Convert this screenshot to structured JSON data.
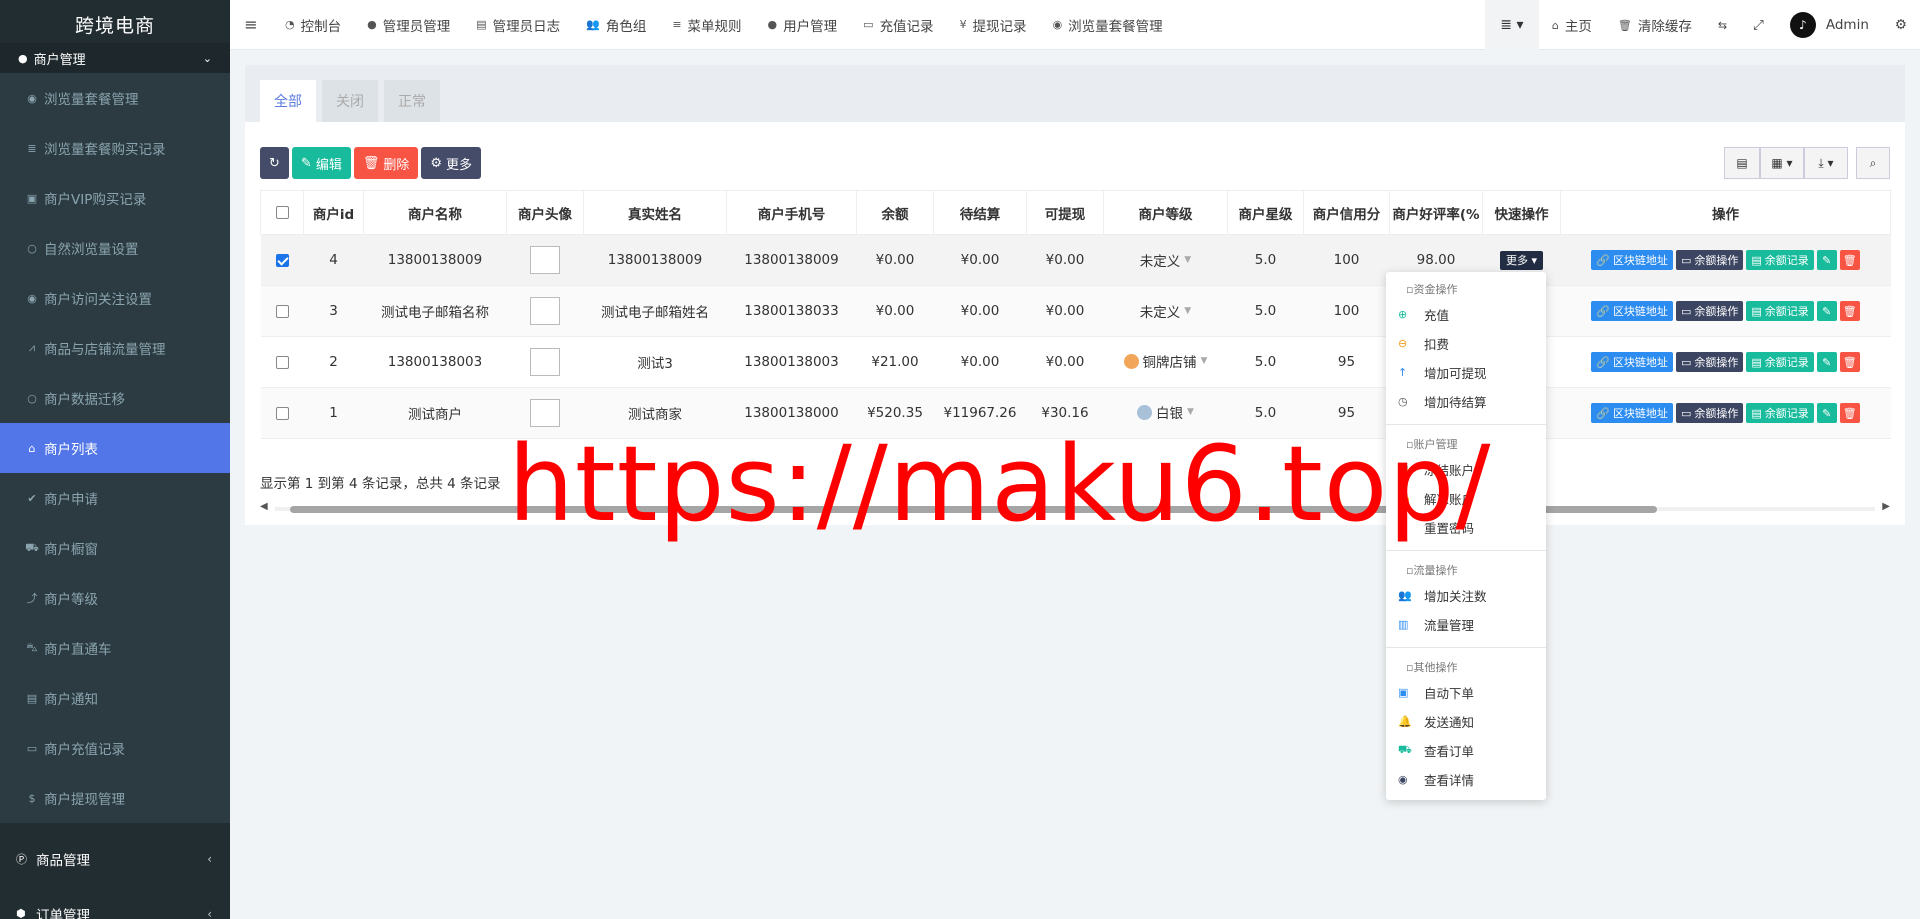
{
  "app": {
    "title": "跨境电商"
  },
  "sidebar": {
    "group_open": "商户管理",
    "items": [
      {
        "icon": "eye-icon",
        "glyph": "◉",
        "label": "浏览量套餐管理"
      },
      {
        "icon": "list-icon",
        "glyph": "≣",
        "label": "浏览量套餐购买记录"
      },
      {
        "icon": "shopping-bag-icon",
        "glyph": "▣",
        "label": "商户VIP购买记录"
      },
      {
        "icon": "circle-icon",
        "glyph": "○",
        "label": "自然浏览量设置"
      },
      {
        "icon": "eye-icon",
        "glyph": "◉",
        "label": "商户访问关注设置"
      },
      {
        "icon": "line-chart-icon",
        "glyph": "⩘",
        "label": "商品与店铺流量管理"
      },
      {
        "icon": "circle-icon",
        "glyph": "○",
        "label": "商户数据迁移"
      },
      {
        "icon": "home-icon",
        "glyph": "⌂",
        "label": "商户列表"
      },
      {
        "icon": "check-circle-icon",
        "glyph": "✔",
        "label": "商户申请"
      },
      {
        "icon": "cart-icon",
        "glyph": "⛟",
        "label": "商户橱窗"
      },
      {
        "icon": "level-up-icon",
        "glyph": "⤴",
        "label": "商户等级"
      },
      {
        "icon": "car-icon",
        "glyph": "⛍",
        "label": "商户直通车"
      },
      {
        "icon": "newspaper-icon",
        "glyph": "▤",
        "label": "商户通知"
      },
      {
        "icon": "money-icon",
        "glyph": "▭",
        "label": "商户充值记录"
      },
      {
        "icon": "dollar-icon",
        "glyph": "$",
        "label": "商户提现管理"
      }
    ],
    "bottom": [
      {
        "icon": "product-hunt-icon",
        "glyph": "Ⓟ",
        "label": "商品管理"
      },
      {
        "icon": "cube-icon",
        "glyph": "⬢",
        "label": "订单管理"
      }
    ]
  },
  "topbar": {
    "items": [
      {
        "icon": "dashboard-icon",
        "glyph": "◔",
        "label": "控制台"
      },
      {
        "icon": "user-icon",
        "glyph": "●",
        "label": "管理员管理"
      },
      {
        "icon": "list-alt-icon",
        "glyph": "▤",
        "label": "管理员日志"
      },
      {
        "icon": "users-icon",
        "glyph": "👥",
        "label": "角色组"
      },
      {
        "icon": "bars-icon",
        "glyph": "≡",
        "label": "菜单规则"
      },
      {
        "icon": "user-icon",
        "glyph": "●",
        "label": "用户管理"
      },
      {
        "icon": "money-icon",
        "glyph": "▭",
        "label": "充值记录"
      },
      {
        "icon": "yen-icon",
        "glyph": "¥",
        "label": "提现记录"
      },
      {
        "icon": "eye-icon",
        "glyph": "◉",
        "label": "浏览量套餐管理"
      }
    ],
    "home": "主页",
    "clear_cache": "清除缓存",
    "user": "Admin"
  },
  "tabs": [
    "全部",
    "关闭",
    "正常"
  ],
  "toolbar": {
    "edit": "编辑",
    "delete": "删除",
    "more": "更多"
  },
  "table": {
    "headers": [
      "商户id",
      "商户名称",
      "商户头像",
      "真实姓名",
      "商户手机号",
      "余额",
      "待结算",
      "可提现",
      "商户等级",
      "商户星级",
      "商户信用分",
      "商户好评率(%",
      "快速操作",
      "操作"
    ],
    "rows": [
      {
        "id": "4",
        "name": "13800138009",
        "real": "13800138009",
        "phone": "13800138009",
        "balance": "¥0.00",
        "pending": "¥0.00",
        "withdraw": "¥0.00",
        "level": "未定义",
        "star": "5.0",
        "credit": "100",
        "rate": "98.00",
        "checked": true
      },
      {
        "id": "3",
        "name": "测试电子邮箱名称",
        "real": "测试电子邮箱姓名",
        "phone": "13800138033",
        "balance": "¥0.00",
        "pending": "¥0.00",
        "withdraw": "¥0.00",
        "level": "未定义",
        "star": "5.0",
        "credit": "100",
        "rate": "",
        "checked": false
      },
      {
        "id": "2",
        "name": "13800138003",
        "real": "测试3",
        "phone": "13800138003",
        "balance": "¥21.00",
        "pending": "¥0.00",
        "withdraw": "¥0.00",
        "level": "铜牌店铺",
        "star": "5.0",
        "credit": "95",
        "rate": "",
        "checked": false
      },
      {
        "id": "1",
        "name": "测试商户",
        "real": "测试商家",
        "phone": "13800138000",
        "balance": "¥520.35",
        "pending": "¥11967.26",
        "withdraw": "¥30.16",
        "level": "白银",
        "star": "5.0",
        "credit": "95",
        "rate": "",
        "checked": false
      }
    ],
    "quick_more": "更多",
    "ops": {
      "chain": "区块链地址",
      "balance_op": "余额操作",
      "balance_log": "余额记录"
    }
  },
  "pager": "显示第 1 到第 4 条记录，总共 4 条记录",
  "dropdown": {
    "sections": [
      {
        "title": "资金操作",
        "items": [
          {
            "icon": "plus-circle-icon",
            "glyph": "⊕",
            "color": "#18bc9c",
            "label": "充值"
          },
          {
            "icon": "minus-circle-icon",
            "glyph": "⊖",
            "color": "#f39c12",
            "label": "扣费"
          },
          {
            "icon": "arrow-up-icon",
            "glyph": "↑",
            "color": "#2d8cf0",
            "label": "增加可提现"
          },
          {
            "icon": "clock-icon",
            "glyph": "◷",
            "color": "#555555",
            "label": "增加待结算"
          }
        ]
      },
      {
        "title": "账户管理",
        "items": [
          {
            "icon": "lock-icon",
            "glyph": "🔒",
            "color": "#f75444",
            "label": "冻结账户"
          },
          {
            "icon": "unlock-icon",
            "glyph": "🔓",
            "color": "#18bc9c",
            "label": "解冻账户"
          },
          {
            "icon": "key-icon",
            "glyph": "⚷",
            "color": "#2d8cf0",
            "label": "重置密码"
          }
        ]
      },
      {
        "title": "流量操作",
        "items": [
          {
            "icon": "users-icon",
            "glyph": "👥",
            "color": "#3c4561",
            "label": "增加关注数"
          },
          {
            "icon": "bar-chart-icon",
            "glyph": "▥",
            "color": "#2d8cf0",
            "label": "流量管理"
          }
        ]
      },
      {
        "title": "其他操作",
        "items": [
          {
            "icon": "shopping-bag-icon",
            "glyph": "▣",
            "color": "#2d8cf0",
            "label": "自动下单"
          },
          {
            "icon": "bell-icon",
            "glyph": "🔔",
            "color": "#f39c12",
            "label": "发送通知"
          },
          {
            "icon": "cart-icon",
            "glyph": "⛟",
            "color": "#18bc9c",
            "label": "查看订单"
          },
          {
            "icon": "eye-icon",
            "glyph": "◉",
            "color": "#3c4561",
            "label": "查看详情"
          }
        ]
      }
    ]
  },
  "watermark": "https://maku6.top/"
}
